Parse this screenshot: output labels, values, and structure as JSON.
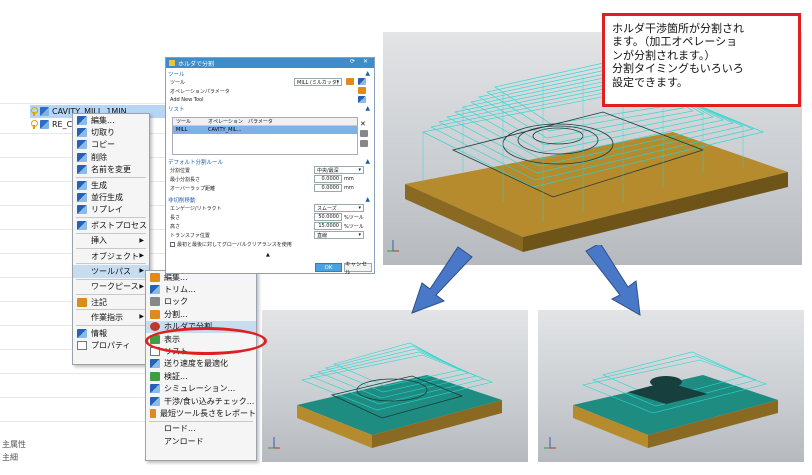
{
  "callout": {
    "lines": [
      "ホルダ干渉箇所が分割され",
      "ます。（加工オペレーショ",
      "ンが分割されます。）",
      "分割タイミングもいろいろ",
      "設定できます。"
    ]
  },
  "tree": {
    "rows": [
      {
        "label": "CAVITY_MILL_1MIN",
        "selected": true
      },
      {
        "label": "RE_CA",
        "selected": false
      }
    ],
    "bottom_rows": [
      "主属性",
      "主細"
    ]
  },
  "context_menu": {
    "items": [
      {
        "label": "編集...",
        "icon": "edit-icon",
        "sub": false
      },
      {
        "label": "切取り",
        "icon": "cut-icon",
        "sub": false
      },
      {
        "label": "コピー",
        "icon": "copy-icon",
        "sub": false
      },
      {
        "label": "削除",
        "icon": "delete-icon",
        "sub": false
      },
      {
        "label": "名前を変更",
        "icon": "rename-icon",
        "sub": false
      },
      {
        "sep": true
      },
      {
        "label": "生成",
        "icon": "generate-icon",
        "sub": false
      },
      {
        "label": "並行生成",
        "icon": "parallel-generate-icon",
        "sub": false
      },
      {
        "label": "リプレイ",
        "icon": "replay-icon",
        "sub": false
      },
      {
        "sep": true
      },
      {
        "label": "ポストプロセス",
        "icon": "postprocess-icon",
        "sub": false
      },
      {
        "sep": true
      },
      {
        "label": "挿入",
        "icon": "",
        "sub": true
      },
      {
        "sep": true
      },
      {
        "label": "オブジェクト",
        "icon": "",
        "sub": true
      },
      {
        "sep": true
      },
      {
        "label": "ツールパス",
        "icon": "",
        "sub": true,
        "highlight": true
      },
      {
        "sep": true
      },
      {
        "label": "ワークピース",
        "icon": "",
        "sub": true
      },
      {
        "sep": true
      },
      {
        "label": "注記",
        "icon": "note-icon",
        "sub": false
      },
      {
        "sep": true
      },
      {
        "label": "作業指示",
        "icon": "",
        "sub": true
      },
      {
        "sep": true
      },
      {
        "label": "情報",
        "icon": "info-icon",
        "sub": false
      },
      {
        "label": "プロパティ",
        "icon": "properties-icon",
        "sub": false
      }
    ]
  },
  "toolpath_menu": {
    "items": [
      {
        "label": "編集...",
        "icon": "edit-toolpath-icon"
      },
      {
        "label": "トリム...",
        "icon": "trim-icon"
      },
      {
        "label": "ロック",
        "icon": "lock-icon"
      },
      {
        "label": "分割...",
        "icon": "split-icon"
      },
      {
        "label": "ホルダで分割...",
        "icon": "split-by-holder-icon",
        "highlight": true
      },
      {
        "label": "表示",
        "icon": "display-icon"
      },
      {
        "label": "リスト",
        "icon": "list-icon"
      },
      {
        "label": "送り速度を最適化",
        "icon": "feedrate-icon"
      },
      {
        "label": "検証...",
        "icon": "verify-icon"
      },
      {
        "label": "シミュレーション...",
        "icon": "simulation-icon"
      },
      {
        "label": "干渉/食い込みチェック...",
        "icon": "gouge-check-icon"
      },
      {
        "label": "最短ツール長さをレポート",
        "icon": "tool-length-icon"
      },
      {
        "sep": true
      },
      {
        "label": "ロード...",
        "icon": ""
      },
      {
        "label": "アンロード",
        "icon": ""
      }
    ],
    "partial_label": "ホルダで分割"
  },
  "dialog": {
    "title": "ホルダで分割",
    "groups": {
      "tool": "ツール",
      "list": "リスト",
      "default_split": "デフォルト分割ルール",
      "noncut": "非切削移動"
    },
    "fields": {
      "tool_label": "ツール",
      "tool_value": "MILL (ミルカッタ)",
      "op_param": "オペレーションパラメータ",
      "add_new_tool": "Add New Tool",
      "list_headers": [
        "ツール",
        "オペレーション",
        "パラメータ"
      ],
      "list_row": [
        "MILL",
        "CAVITY_MIL...",
        ""
      ],
      "split_position": "分割位置",
      "split_position_value": "中央/最深",
      "min_split_length": "最小分割長さ",
      "min_split_length_value": "0.0000",
      "overlap_distance": "オーバーラップ距離",
      "overlap_distance_value": "0.0000",
      "unit_mm": "mm",
      "engage_retract": "エンゲージ/リトラクト",
      "engage_retract_value": "スムーズ",
      "length": "長さ",
      "length_value": "50.0000",
      "height": "高さ",
      "height_value": "15.0000",
      "unit_pct": "%ツール",
      "transfer_position": "トランスファ位置",
      "transfer_position_value": "直線",
      "clearance_check": "最初と最後に対してグローバルクリアランスを使用"
    },
    "ok": "OK",
    "cancel": "キャンセル"
  },
  "colors": {
    "accent_red": "#e02020",
    "arrow_blue": "#4a78c8",
    "toolpath_cyan": "#26d6d0",
    "stock_teal": "#1f8c82",
    "stock_gold": "#b68b2e"
  }
}
